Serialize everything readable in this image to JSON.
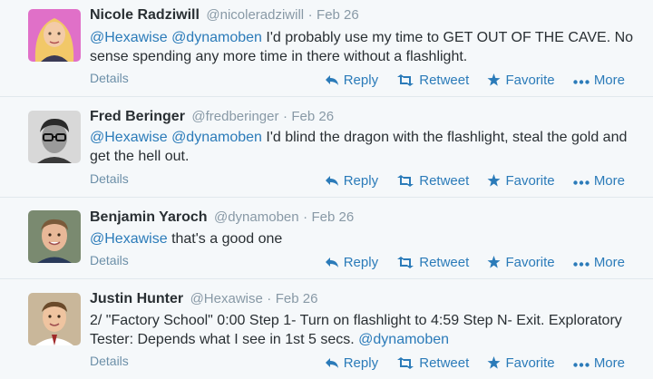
{
  "actions": {
    "reply": "Reply",
    "retweet": "Retweet",
    "favorite": "Favorite",
    "more": "More",
    "details": "Details"
  },
  "tweets": [
    {
      "name": "Nicole Radziwill",
      "handle": "@nicoleradziwill",
      "sep": "·",
      "time": "Feb 26",
      "mentions": [
        "@Hexawise",
        "@dynamoben"
      ],
      "text": "I'd probably use my time to GET OUT OF THE CAVE. No sense spending any more time in there without a flashlight."
    },
    {
      "name": "Fred Beringer",
      "handle": "@fredberinger",
      "sep": "·",
      "time": "Feb 26",
      "mentions": [
        "@Hexawise",
        "@dynamoben"
      ],
      "text": "I'd blind the dragon with the flashlight, steal the gold and get the hell out."
    },
    {
      "name": "Benjamin Yaroch",
      "handle": "@dynamoben",
      "sep": "·",
      "time": "Feb 26",
      "mentions": [
        "@Hexawise"
      ],
      "text": "that's a good one"
    },
    {
      "name": "Justin Hunter",
      "handle": "@Hexawise",
      "sep": "·",
      "time": "Feb 26",
      "text_before": "2/ \"Factory School\" 0:00 Step 1- Turn on flashlight to 4:59 Step N- Exit. Exploratory Tester: Depends what I see in 1st 5 secs.",
      "mention_after": "@dynamoben"
    }
  ],
  "colors": {
    "link": "#2b7bb9",
    "muted": "#8899a6",
    "text": "#292f33",
    "background": "#f5f8fa"
  }
}
